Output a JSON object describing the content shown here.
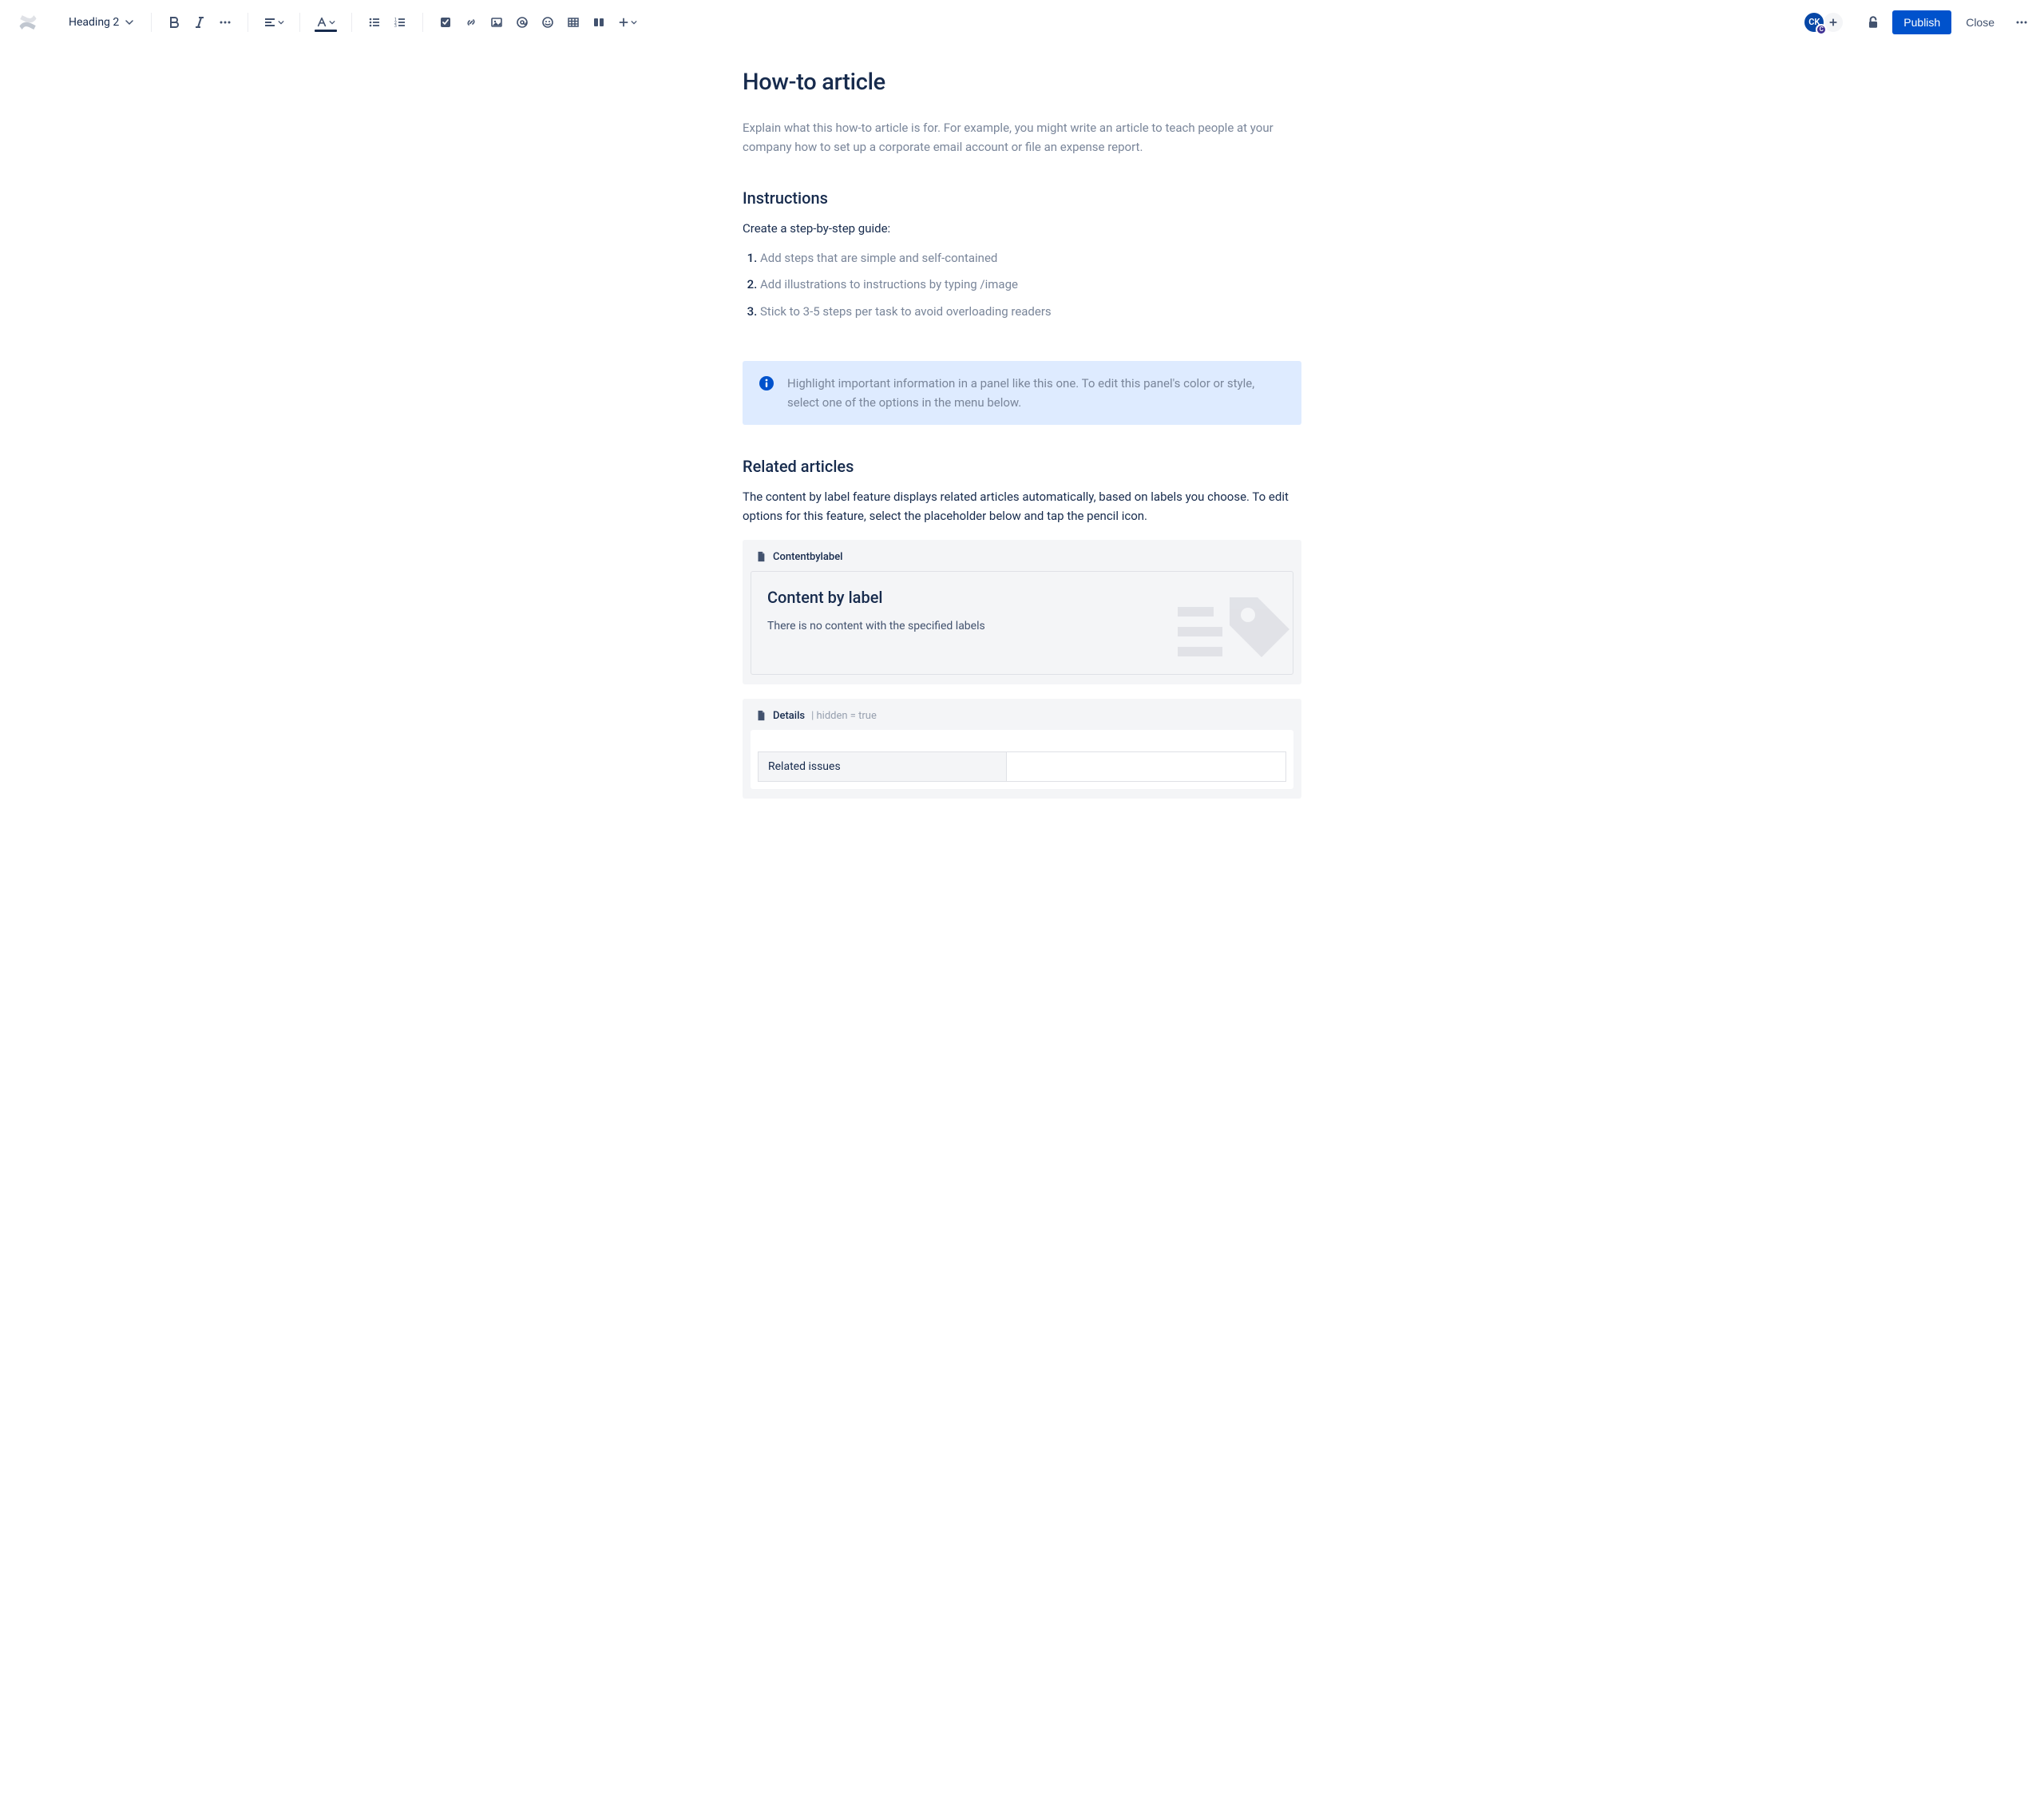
{
  "toolbar": {
    "heading_label": "Heading 2",
    "avatar_initials": "CK",
    "avatar_badge": "C",
    "publish_label": "Publish",
    "close_label": "Close"
  },
  "page": {
    "title": "How-to article",
    "intro": "Explain what this how-to article is for. For example, you might write an article to teach people at your company how to set up a corporate email account or file an expense report.",
    "instructions_heading": "Instructions",
    "instructions_lead": "Create a step-by-step guide:",
    "steps": [
      "Add steps that are simple and self-contained",
      "Add illustrations to instructions by typing /image",
      "Stick to 3-5 steps per task to avoid overloading readers"
    ],
    "info_panel": "Highlight important information in a panel like this one. To edit this panel's color or style, select one of the options in the menu below.",
    "related_heading": "Related articles",
    "related_desc": "The content by label feature displays related articles automatically, based on labels you choose. To edit options for this feature, select the placeholder below and tap the pencil icon.",
    "cbl_macro_name": "Contentbylabel",
    "cbl_title": "Content by label",
    "cbl_empty": "There is no content with the specified labels",
    "details_macro_name": "Details",
    "details_meta": " | hidden = true",
    "details_row_label": "Related issues"
  }
}
